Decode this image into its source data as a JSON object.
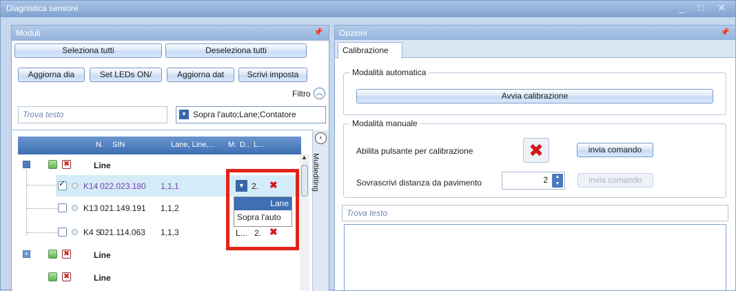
{
  "window": {
    "title": "Diagnistica sensore",
    "controls": "_ □ ✕"
  },
  "moduli": {
    "title": "Moduli",
    "select_all": "Seleziona tutti",
    "deselect_all": "Deseleziona tutti",
    "buttons": [
      "Aggiorna dia",
      "Set LEDs ON/",
      "Aggiorna dat",
      "Scrivi imposta"
    ],
    "filter_label": "Filtro",
    "search_placeholder": "Trova testo",
    "filter_value": "Sopra l'auto;Lane;Contatore",
    "multiediting": "Multiediting",
    "columns": {
      "n": "N.",
      "sin": "SIN",
      "lane": "Lane, Line,...",
      "m": "M.",
      "d": "D..",
      "l": "L..."
    },
    "rows": [
      {
        "type": "group",
        "label": "Line"
      },
      {
        "type": "item",
        "n": "K14",
        "sin": "022.023.180",
        "lane": "1,1,1",
        "d": "2.",
        "selected": true
      },
      {
        "type": "item",
        "n": "K13",
        "sin": "021.149.191",
        "lane": "1,1,2"
      },
      {
        "type": "item",
        "n": "K4 S",
        "sin": "021.114.063",
        "lane": "1,1,3",
        "m": "L...",
        "d": "2."
      },
      {
        "type": "group",
        "label": "Line"
      },
      {
        "type": "group",
        "label": "Line"
      }
    ],
    "dropdown_options": [
      "Lane",
      "Sopra l'auto"
    ]
  },
  "opzioni": {
    "title": "Opzioni",
    "tab": "Calibrazione",
    "auto_group": "Modalità automatica",
    "avvia": "Avvia calibrazione",
    "manual_group": "Modalità manuale",
    "abilita_label": "Abilita pulsante per calibrazione",
    "invia1": "invia comando",
    "sovrascrivi_label": "Sovrascrivi distanza da pavimento",
    "distance_value": "2",
    "invia2": "invia comando",
    "search_placeholder": "Trova testo"
  },
  "colors": {
    "highlight": "#e2231a",
    "selected_row": "#d4ecf7",
    "purple_text": "#7a3fb0"
  }
}
